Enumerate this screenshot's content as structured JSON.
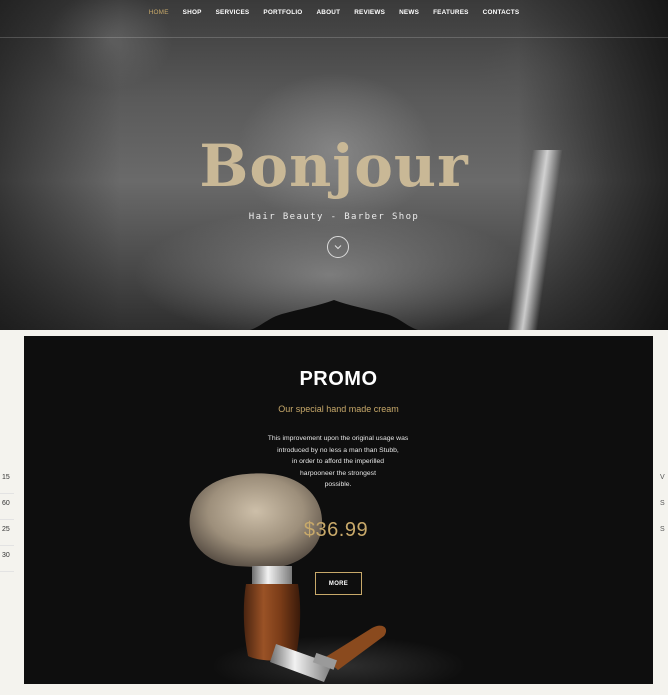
{
  "nav": {
    "items": [
      {
        "label": "HOME",
        "active": true
      },
      {
        "label": "SHOP"
      },
      {
        "label": "SERVICES"
      },
      {
        "label": "PORTFOLIO"
      },
      {
        "label": "ABOUT"
      },
      {
        "label": "REVIEWS"
      },
      {
        "label": "NEWS"
      },
      {
        "label": "FEATURES"
      },
      {
        "label": "CONTACTS"
      }
    ]
  },
  "hero": {
    "title": "Bonjour",
    "subtitle": "Hair Beauty - Barber Shop",
    "scroll_icon": "chevron-down-circle-icon"
  },
  "promo": {
    "title": "PROMO",
    "subtitle": "Our special hand made cream",
    "body_lines": [
      "This improvement upon the original usage was",
      "introduced by no less a man than Stubb,",
      "in order to afford the imperilled",
      "harpooneer the strongest",
      "possible."
    ],
    "price": "$36.99",
    "more_label": "MORE"
  },
  "side_left": [
    "15",
    "60",
    "25",
    "30"
  ],
  "side_right": [
    "V",
    "S",
    "S"
  ],
  "colors": {
    "accent": "#c8a96a",
    "title_gold": "#c9b896",
    "promo_bg": "#0e0e0e",
    "page_bg": "#f4f3ee"
  }
}
